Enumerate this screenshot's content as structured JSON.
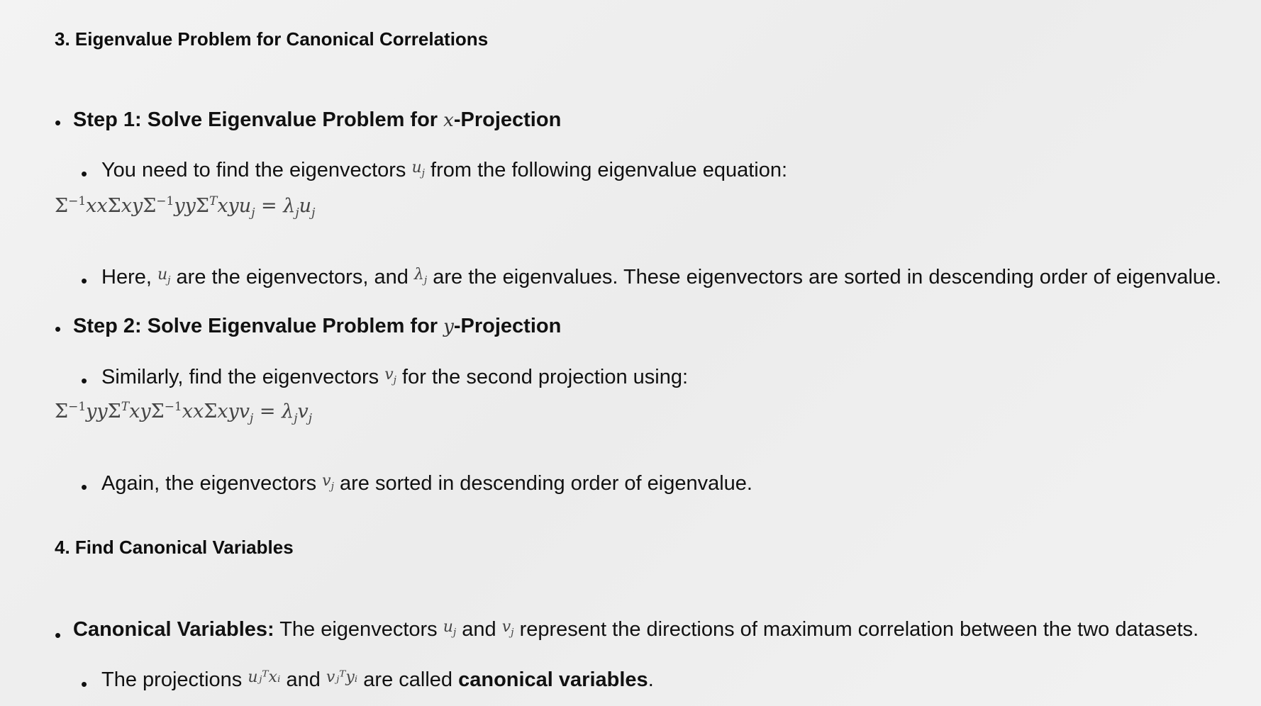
{
  "section3": {
    "heading": "3. Eigenvalue Problem for Canonical Correlations",
    "step1": {
      "title_prefix": "Step 1: Solve Eigenvalue Problem for ",
      "title_var": "x",
      "title_suffix": "-Projection",
      "line1_a": "You need to find the eigenvectors ",
      "line1_var": "u",
      "line1_b": " from the following eigenvalue equation:",
      "equation": "Σ⁻¹xxΣxyΣ⁻¹yyΣᵀxyuⱼ = λⱼuⱼ",
      "line2_a": "Here, ",
      "line2_var1": "u",
      "line2_b": " are the eigenvectors, and ",
      "line2_var2": "λ",
      "line2_c": " are the eigenvalues. These eigenvectors are sorted in descending order of eigenvalue."
    },
    "step2": {
      "title_prefix": "Step 2: Solve Eigenvalue Problem for ",
      "title_var": "y",
      "title_suffix": "-Projection",
      "line1_a": "Similarly, find the eigenvectors ",
      "line1_var": "v",
      "line1_b": " for the second projection using:",
      "equation": "Σ⁻¹yyΣᵀxyΣ⁻¹xxΣxyvⱼ = λⱼvⱼ",
      "line2_a": "Again, the eigenvectors ",
      "line2_var": "v",
      "line2_b": " are sorted in descending order of eigenvalue."
    }
  },
  "section4": {
    "heading": "4. Find Canonical Variables",
    "item": {
      "label": "Canonical Variables:",
      "text_a": " The eigenvectors ",
      "var1": "u",
      "text_b": " and ",
      "var2": "v",
      "text_c": " represent the directions of maximum correlation between the two datasets."
    },
    "sub": {
      "text_a": "The projections ",
      "expr1": "uⱼᵀxᵢ",
      "text_b": " and ",
      "expr2": "vⱼᵀyᵢ",
      "text_c": " are called ",
      "bold": "canonical variables",
      "text_d": "."
    }
  },
  "bullet_glyph": "•",
  "colors": {
    "background": "#f0f0f0",
    "text": "#111111",
    "math": "#444444"
  }
}
